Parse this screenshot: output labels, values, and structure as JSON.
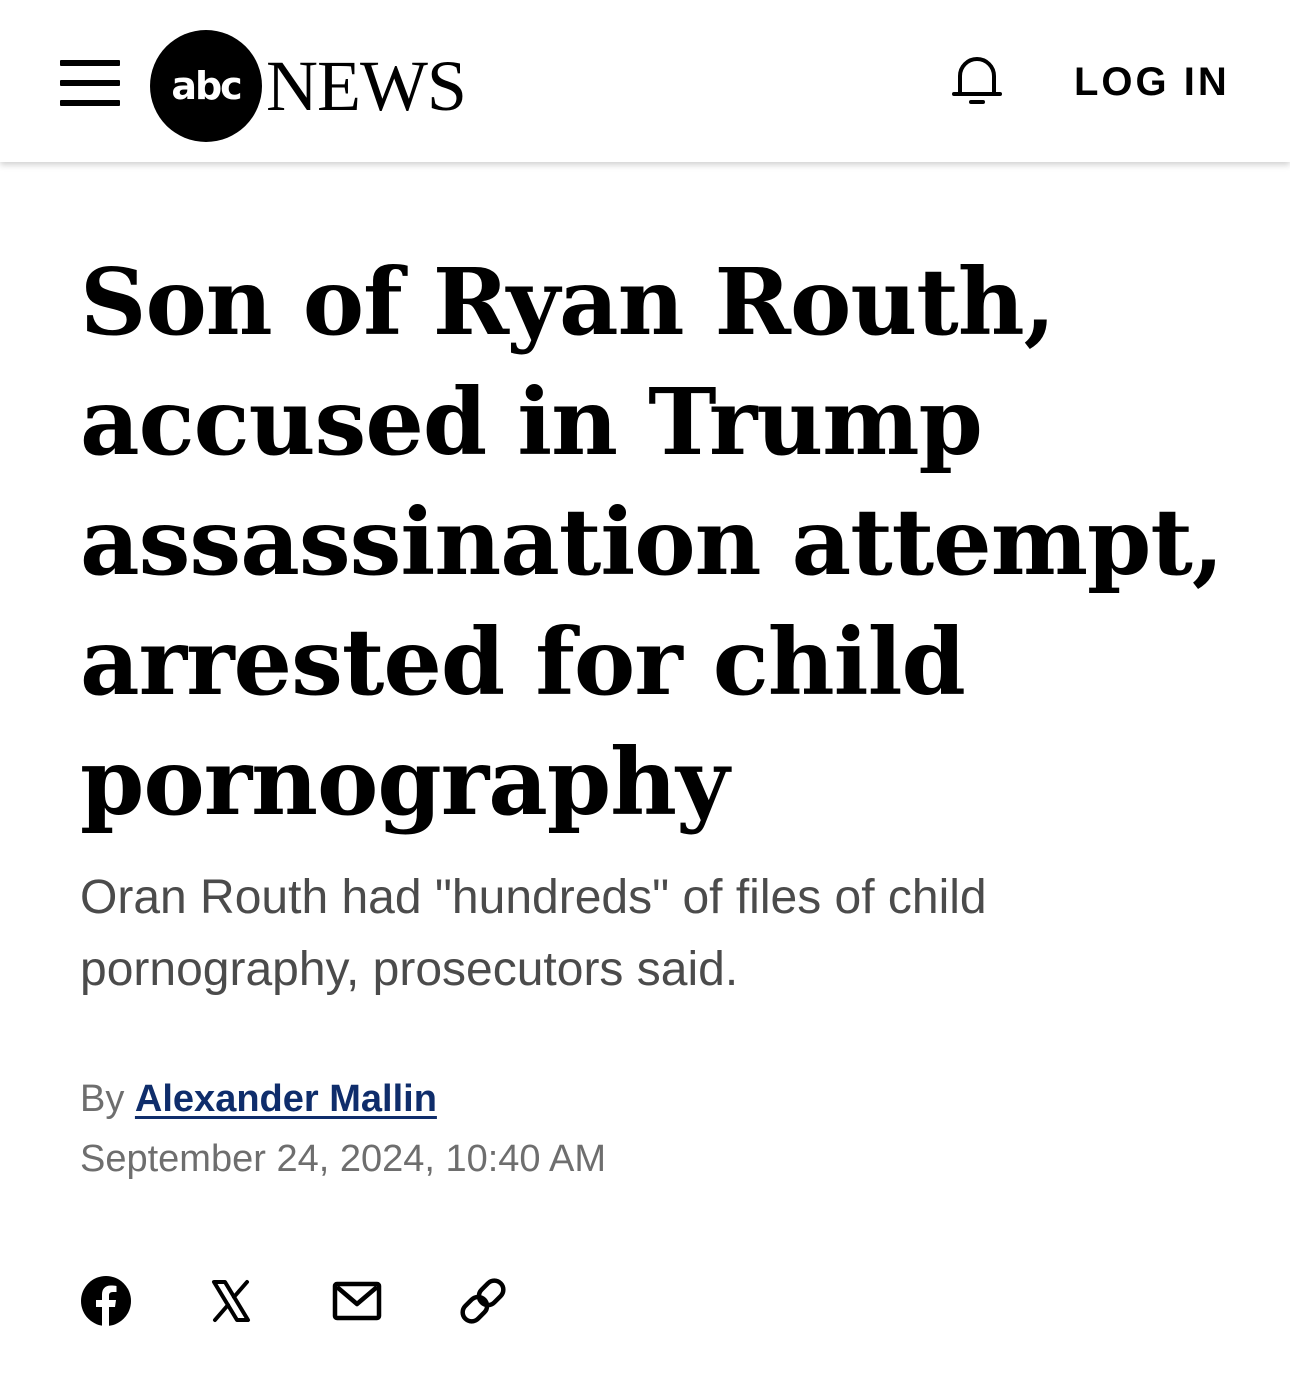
{
  "header": {
    "logo_abc": "abc",
    "logo_news": "NEWS",
    "login_label": "LOG IN"
  },
  "article": {
    "headline": "Son of Ryan Routh, accused in Trump assassination attempt, arrested for child pornography",
    "subheadline": "Oran Routh had \"hundreds\" of files of child pornography, prosecutors said.",
    "byline_prefix": "By",
    "author": "Alexander Mallin",
    "timestamp": "September 24, 2024, 10:40 AM"
  },
  "share_icons": [
    "facebook-icon",
    "x-icon",
    "email-icon",
    "link-icon"
  ],
  "colors": {
    "text": "#000000",
    "subhead": "#4b4b4b",
    "meta": "#6e6e6e",
    "author_link": "#0f2d6b"
  }
}
